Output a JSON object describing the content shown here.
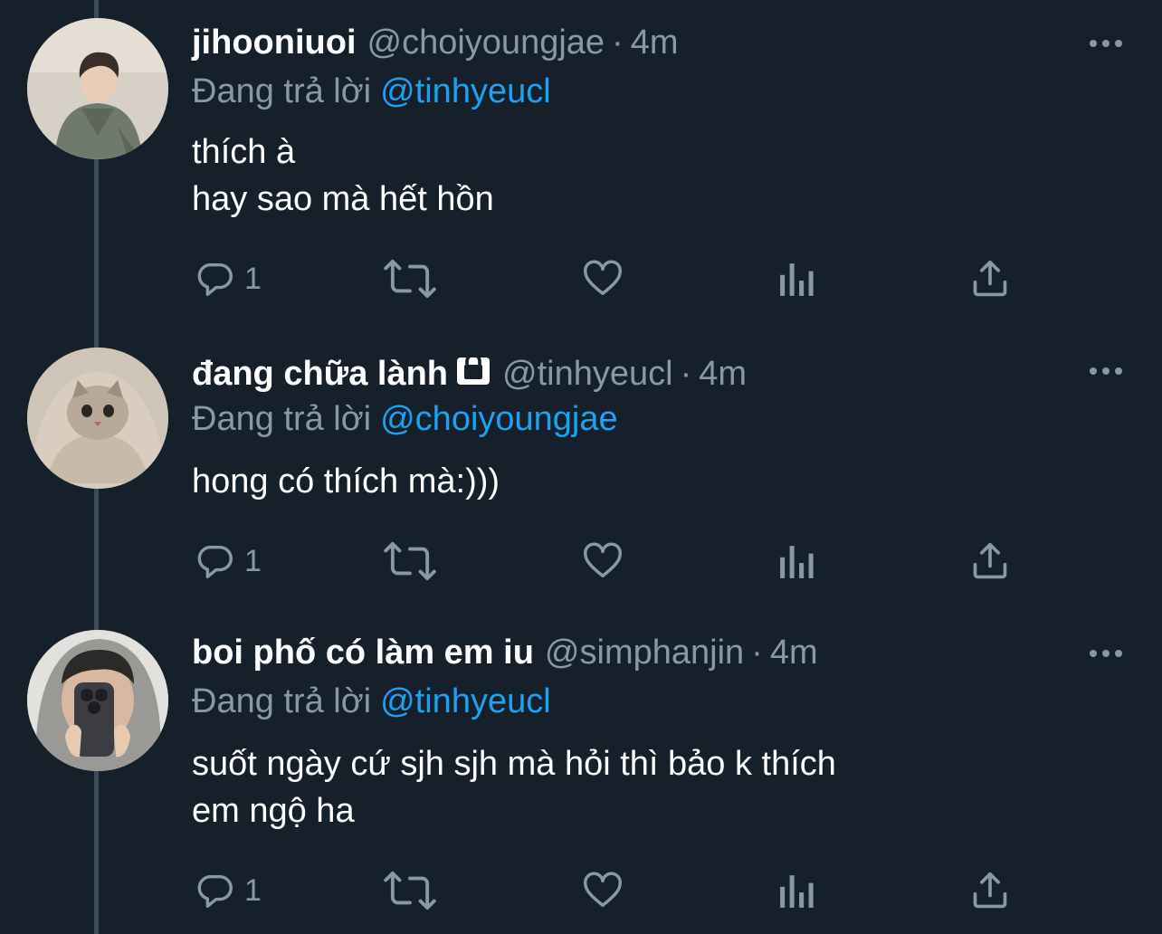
{
  "tweets": [
    {
      "display_name": "jihooniuoi",
      "handle": "@choiyoungjae",
      "separator": "·",
      "time": "4m",
      "reply_prefix": "Đang trả lời",
      "reply_to": "@tinhyeucl",
      "text_lines": [
        "thích à",
        "hay sao mà hết hồn"
      ],
      "reply_count": "1",
      "avatar": "person-avatar",
      "locked": false
    },
    {
      "display_name": "đang chữa lành",
      "handle": "@tinhyeucl",
      "separator": "·",
      "time": "4m",
      "reply_prefix": "Đang trả lời",
      "reply_to": "@choiyoungjae",
      "text_lines": [
        "hong có thích mà:)))"
      ],
      "reply_count": "1",
      "avatar": "cat-avatar",
      "locked": true
    },
    {
      "display_name": "boi phố có làm em iu",
      "handle": "@simphanjin",
      "separator": "·",
      "time": "4m",
      "reply_prefix": "Đang trả lời",
      "reply_to": "@tinhyeucl",
      "text_lines": [
        "suốt ngày cứ sjh sjh mà hỏi thì bảo k thích",
        "em ngộ ha"
      ],
      "reply_count": "1",
      "avatar": "mirror-selfie-avatar",
      "locked": false
    }
  ],
  "icons": {
    "reply": "reply-icon",
    "retweet": "retweet-icon",
    "like": "heart-icon",
    "analytics": "analytics-icon",
    "share": "share-icon",
    "more": "more-icon",
    "lock": "lock-icon"
  },
  "colors": {
    "background": "#15202b",
    "text_primary": "#ffffff",
    "text_secondary": "#8899a6",
    "accent": "#1da1f2",
    "thread_line": "#3d4a57"
  }
}
